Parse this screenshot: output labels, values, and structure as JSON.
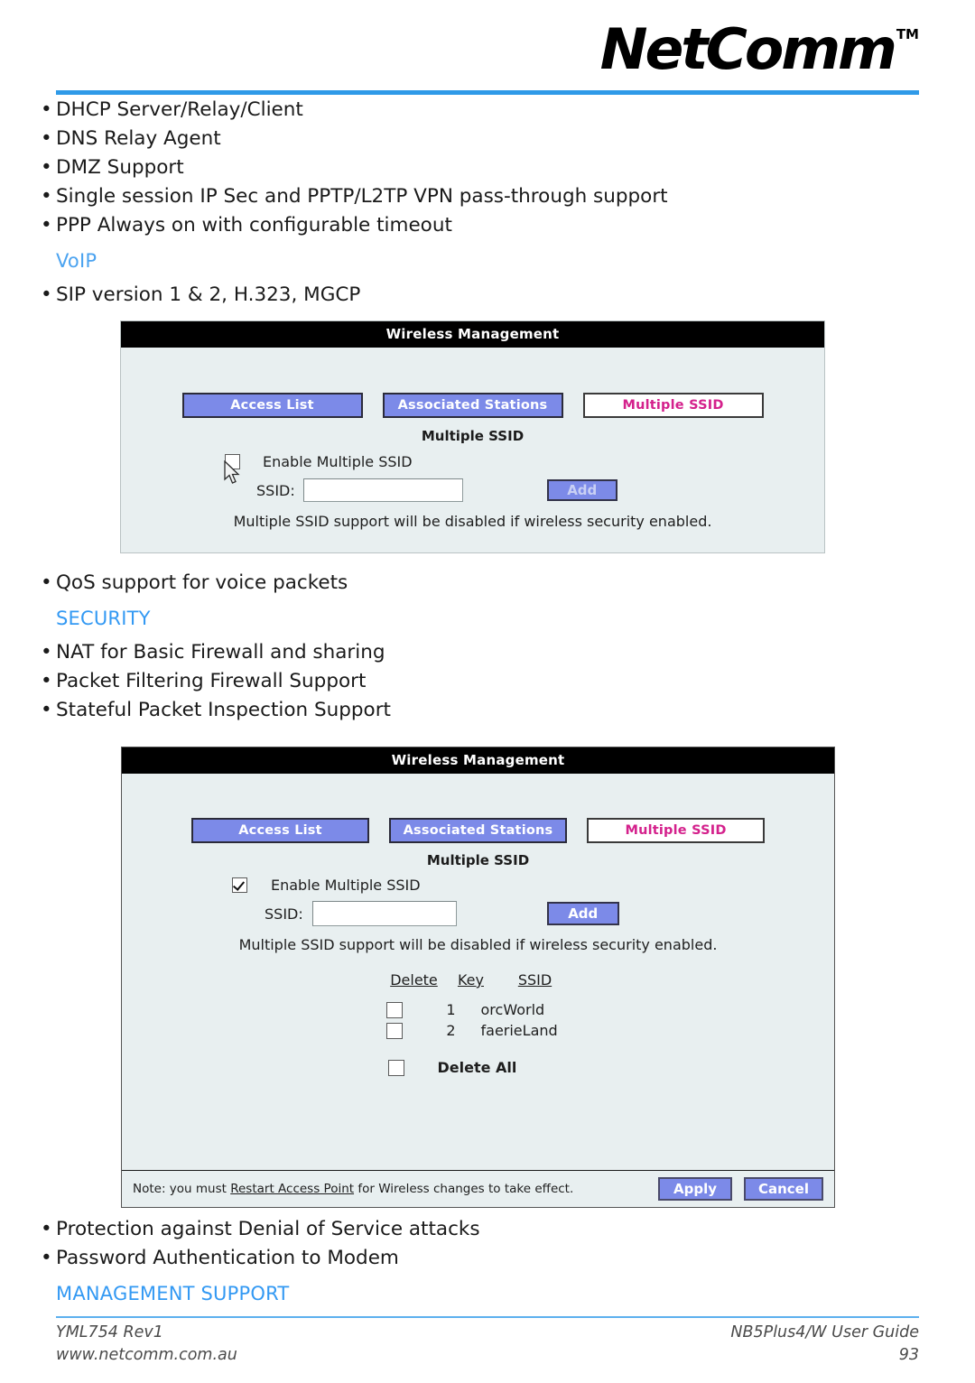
{
  "header": {
    "brand": "NetComm",
    "trademark": "TM"
  },
  "intro_bullets": [
    "DHCP Server/Relay/Client",
    "DNS Relay Agent",
    "DMZ Support",
    "Single session IP Sec and PPTP/L2TP VPN pass-through support",
    "PPP Always on with configurable timeout"
  ],
  "voip": {
    "heading": "VoIP",
    "bullets_before": [
      "SIP version 1 & 2, H.323, MGCP"
    ],
    "bullets_after": [
      "QoS support for voice packets"
    ]
  },
  "security": {
    "heading": "SECURITY",
    "bullets": [
      "NAT for Basic Firewall and sharing",
      "Packet Filtering Firewall Support",
      "Stateful Packet Inspection Support"
    ],
    "bullets_after": [
      "Protection against Denial of Service attacks",
      "Password Authentication to Modem"
    ]
  },
  "management": {
    "heading": "MANAGEMENT SUPPORT"
  },
  "screenshot_one": {
    "title": "Wireless Management",
    "tabs": [
      {
        "label": "Access List",
        "active": false
      },
      {
        "label": "Associated Stations",
        "active": false
      },
      {
        "label": "Multiple SSID",
        "active": true
      }
    ],
    "subtitle": "Multiple SSID",
    "enable_label": "Enable Multiple SSID",
    "enable_checked": false,
    "ssid_label": "SSID:",
    "ssid_value": "",
    "ssid_placeholder": "",
    "add_label": "Add",
    "note": "Multiple SSID support will be disabled if wireless security enabled."
  },
  "screenshot_two": {
    "title": "Wireless Management",
    "tabs": [
      {
        "label": "Access List",
        "active": false
      },
      {
        "label": "Associated Stations",
        "active": false
      },
      {
        "label": "Multiple SSID",
        "active": true
      }
    ],
    "subtitle": "Multiple SSID",
    "enable_label": "Enable Multiple SSID",
    "enable_checked": true,
    "ssid_label": "SSID:",
    "ssid_value": "",
    "ssid_placeholder": "",
    "add_label": "Add",
    "note": "Multiple SSID support will be disabled if wireless security enabled.",
    "table": {
      "columns": [
        "Delete",
        "Key",
        "SSID"
      ],
      "rows": [
        {
          "checked": false,
          "key": "1",
          "ssid": "orcWorld"
        },
        {
          "checked": false,
          "key": "2",
          "ssid": "faerieLand"
        }
      ],
      "delete_all_label": "Delete All",
      "delete_all_checked": false
    },
    "footer": {
      "note_prefix": "Note: you must ",
      "note_link": "Restart Access Point",
      "note_suffix": " for Wireless changes to take effect.",
      "apply_label": "Apply",
      "cancel_label": "Cancel"
    }
  },
  "page_footer": {
    "left_line1": "YML754 Rev1",
    "left_line2": "www.netcomm.com.au",
    "right_line1": "NB5Plus4/W User Guide",
    "right_line2": "93"
  },
  "colors": {
    "accent_rule": "#2f9ae8",
    "section_heading": "#3399f3",
    "tab_blue": "#7c8ae8",
    "tab_active_text": "#d4218c",
    "panel_bg": "#e8eff0",
    "titlebar_bg": "#000000",
    "footer_rule": "#5cb0ee"
  }
}
